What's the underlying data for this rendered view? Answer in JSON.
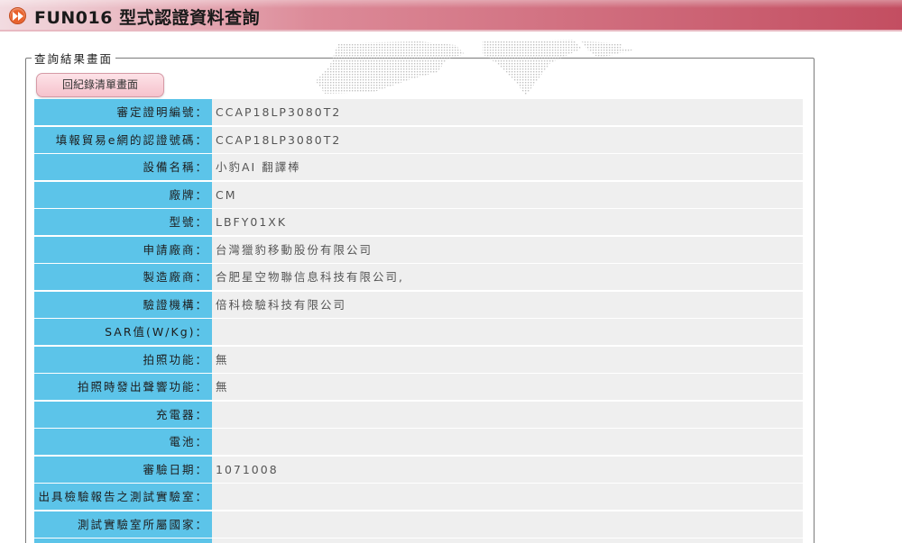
{
  "header": {
    "title": "FUN016 型式認證資料查詢",
    "icon": "fast-forward-icon",
    "icon_color": "#e8612c"
  },
  "result": {
    "legend": "查詢結果畫面",
    "back_button": "回紀錄清單畫面"
  },
  "colors": {
    "label_bg": "#5cc4e9",
    "value_bg": "#efefef",
    "title_gradient_end": "#c34e61"
  },
  "fields": [
    {
      "label": "審定證明編號：",
      "value": "CCAP18LP3080T2"
    },
    {
      "label": "填報貿易e網的認證號碼：",
      "value": "CCAP18LP3080T2"
    },
    {
      "label": "設備名稱：",
      "value": "小豹AI 翻譯棒"
    },
    {
      "label": "廠牌：",
      "value": "CM"
    },
    {
      "label": "型號：",
      "value": "LBFY01XK"
    },
    {
      "label": "申請廠商：",
      "value": "台灣獵豹移動股份有限公司"
    },
    {
      "label": "製造廠商：",
      "value": "合肥星空物聯信息科技有限公司,"
    },
    {
      "label": "驗證機構：",
      "value": "倍科檢驗科技有限公司"
    },
    {
      "label": "SAR值(W/Kg)：",
      "value": ""
    },
    {
      "label": "拍照功能：",
      "value": "無"
    },
    {
      "label": "拍照時發出聲響功能：",
      "value": "無"
    },
    {
      "label": "充電器：",
      "value": ""
    },
    {
      "label": "電池：",
      "value": ""
    },
    {
      "label": "審驗日期：",
      "value": "1071008"
    },
    {
      "label": "出具檢驗報告之測試實驗室：",
      "value": ""
    },
    {
      "label": "測試實驗室所屬國家：",
      "value": ""
    },
    {
      "label": "",
      "value": ""
    }
  ]
}
